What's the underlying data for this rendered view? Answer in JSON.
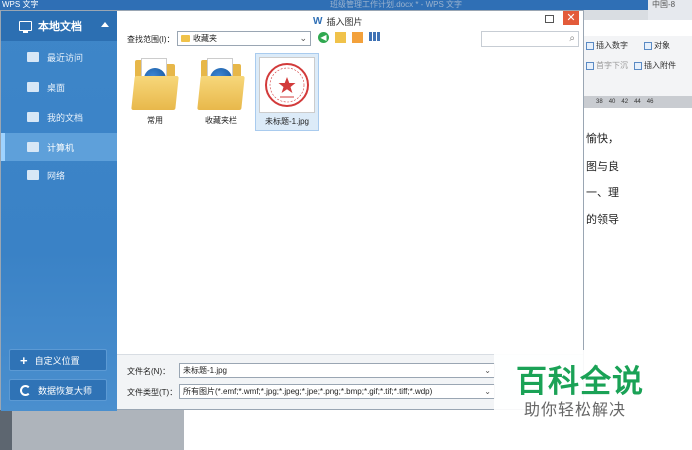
{
  "background": {
    "app_title": "WPS 文字",
    "doc_title": "班级管理工作计划.docx * - WPS 文字",
    "corner_text": "中国-8",
    "toolbar": {
      "insert_number": "插入数字",
      "object": "对象",
      "char_wrap": "首字下沉",
      "insert_attachment": "插入附件"
    },
    "ruler_marks": [
      "38",
      "40",
      "42",
      "44",
      "46"
    ],
    "doc_lines": [
      "愉快，",
      "图与良",
      "一、理",
      "的领导"
    ]
  },
  "dialog": {
    "title": "插入图片",
    "look_in_label": "查找范围(I)：",
    "look_in_value": "收藏夹",
    "search_placeholder": "",
    "file_name_label": "文件名(N)：",
    "file_name_value": "未标题-1.jpg",
    "file_type_label": "文件类型(T)：",
    "file_type_value": "所有图片(*.emf;*.wmf;*.jpg;*.jpeg;*.jpe;*.png;*.bmp;*.gif;*.tif;*.tiff;*.wdp)"
  },
  "sidebar": {
    "header": "本地文档",
    "items": [
      {
        "label": "最近访问",
        "icon": "clock-icon"
      },
      {
        "label": "桌面",
        "icon": "desktop-icon"
      },
      {
        "label": "我的文档",
        "icon": "documents-icon"
      },
      {
        "label": "计算机",
        "icon": "computer-icon"
      },
      {
        "label": "网络",
        "icon": "network-icon"
      }
    ],
    "custom_location": "自定义位置",
    "recovery": "数据恢复大师"
  },
  "files": [
    {
      "name": "常用",
      "type": "folder"
    },
    {
      "name": "收藏夹栏",
      "type": "folder"
    },
    {
      "name": "未标题-1.jpg",
      "type": "image",
      "selected": true
    }
  ],
  "watermark": {
    "main": "百科全说",
    "sub": "助你轻松解决"
  },
  "colors": {
    "accent": "#2f6fb5",
    "sidebar": "#3e86c9",
    "close": "#e35b3a",
    "watermark": "#1aa256",
    "folder": "#e7b749",
    "seal": "#d23a3a"
  }
}
